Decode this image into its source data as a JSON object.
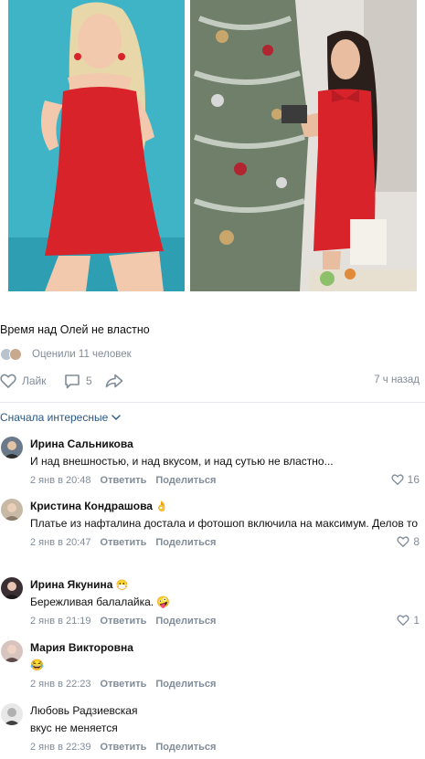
{
  "post": {
    "text": "Время над Олей не властно",
    "likers_text": "Оценили 11 человек",
    "like_label": "Лайк",
    "comments_count": "5",
    "time": "7 ч назад"
  },
  "sort": {
    "label": "Сначала интересные"
  },
  "comments": [
    {
      "name": "Ирина Сальникова",
      "emoji": "",
      "text": "И над внешностью, и над вкусом, и над сутью не властно...",
      "date": "2 янв в 20:48",
      "reply": "Ответить",
      "share": "Поделиться",
      "likes": "16"
    },
    {
      "name": "Кристина Кондрашова",
      "emoji": "👌",
      "text": "Платье из нафталина достала и фотошоп включила на максимум. Делов то",
      "date": "2 янв в 20:47",
      "reply": "Ответить",
      "share": "Поделиться",
      "likes": "8"
    },
    {
      "name": "Ирина Якунина",
      "emoji": "😷",
      "text": "Бережливая балалайка. 🤪",
      "date": "2 янв в 21:19",
      "reply": "Ответить",
      "share": "Поделиться",
      "likes": "1"
    },
    {
      "name": "Мария Викторовна",
      "emoji": "",
      "text": "😂",
      "date": "2 янв в 22:23",
      "reply": "Ответить",
      "share": "Поделиться",
      "likes": ""
    },
    {
      "name": "Любовь Радзиевская",
      "emoji": "",
      "text": "вкус не меняется",
      "date": "2 янв в 22:39",
      "reply": "Ответить",
      "share": "Поделиться",
      "likes": ""
    }
  ],
  "colors": {
    "link": "#2a5885",
    "secondary": "#818c99",
    "dress_red": "#d9232b",
    "photo_left_bg": "#3ab0c4"
  }
}
